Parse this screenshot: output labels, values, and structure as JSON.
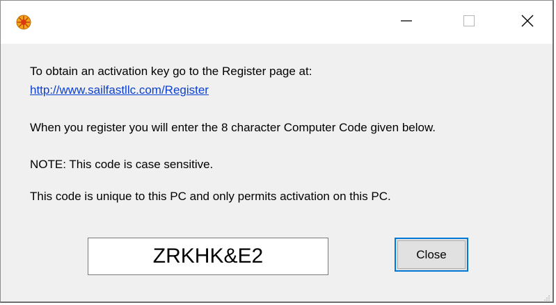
{
  "titlebar": {
    "app_icon": "sun-icon",
    "minimize_icon": "minimize-icon",
    "maximize_icon": "maximize-icon",
    "close_icon": "close-icon"
  },
  "message": {
    "line1": "To obtain an activation key go to the Register page at:",
    "link": "http://www.sailfastllc.com/Register",
    "line2": "When you register you will enter the 8 character Computer Code given below.",
    "line3": "NOTE: This code is case sensitive.",
    "line4": "This code is unique to this PC and only permits activation on this PC."
  },
  "computer_code": "ZRKHK&E2",
  "buttons": {
    "close_label": "Close"
  },
  "colors": {
    "link": "#0b3fcf",
    "focus_border": "#0078d7",
    "dialog_bg": "#f0f0f0"
  }
}
